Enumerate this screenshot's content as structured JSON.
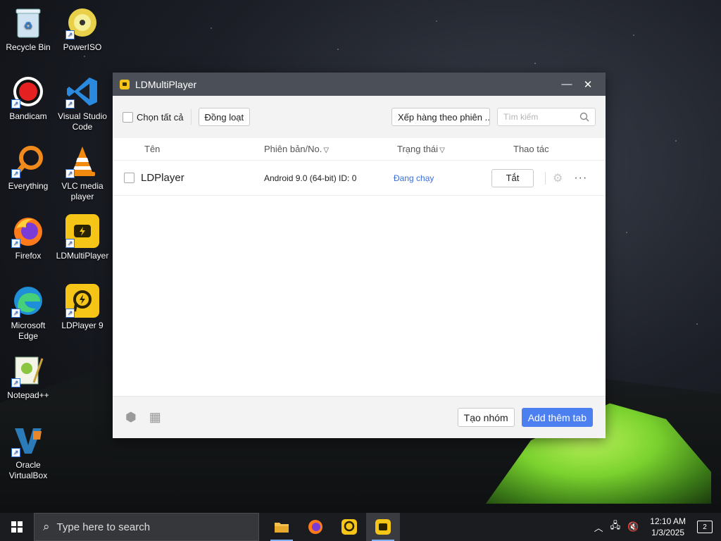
{
  "desktop": {
    "icons": [
      {
        "label": "Recycle Bin"
      },
      {
        "label": "PowerISO"
      },
      {
        "label": "Bandicam"
      },
      {
        "label": "Visual Studio Code"
      },
      {
        "label": "Everything"
      },
      {
        "label": "VLC media player"
      },
      {
        "label": "Firefox"
      },
      {
        "label": "LDMultiPlayer"
      },
      {
        "label": "Microsoft Edge"
      },
      {
        "label": "LDPlayer 9"
      },
      {
        "label": "Notepad++"
      },
      {
        "label": "Oracle VirtualBox"
      }
    ]
  },
  "window": {
    "title": "LDMultiPlayer",
    "minimize_glyph": "—",
    "close_glyph": "✕",
    "toolbar": {
      "select_all_label": "Chọn tất cả",
      "batch_label": "Đồng loạt",
      "sort_label": "Xếp hàng theo phiên ...",
      "search_placeholder": "Tìm kiếm"
    },
    "table": {
      "headers": {
        "name": "Tên",
        "version": "Phiên bản/No.",
        "status": "Trạng thái",
        "actions": "Thao tác"
      },
      "rows": [
        {
          "name": "LDPlayer",
          "version": "Android 9.0 (64-bit) ID: 0",
          "status": "Đang chạy",
          "action_label": "Tắt"
        }
      ]
    },
    "footer": {
      "create_group_label": "Tạo nhóm",
      "add_tab_label": "Add thêm tab"
    }
  },
  "taskbar": {
    "search_placeholder": "Type here to search",
    "time": "12:10 AM",
    "date": "1/3/2025",
    "notification_count": "2"
  }
}
